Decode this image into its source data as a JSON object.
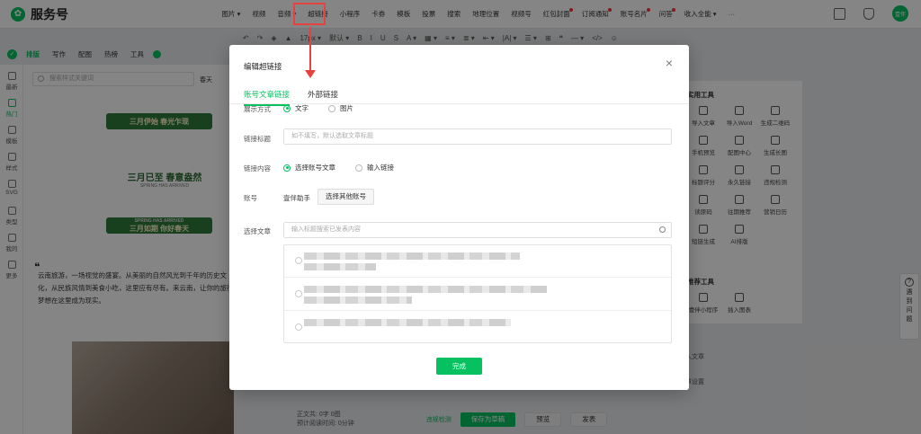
{
  "brand": {
    "name": "服务号"
  },
  "menu": [
    {
      "label": "图片",
      "arrow": "▾",
      "dot": false
    },
    {
      "label": "视频",
      "arrow": "",
      "dot": false
    },
    {
      "label": "音频",
      "arrow": "▾",
      "dot": false
    },
    {
      "label": "超链接",
      "arrow": "",
      "dot": false,
      "highlight": true
    },
    {
      "label": "小程序",
      "arrow": "",
      "dot": false
    },
    {
      "label": "卡券",
      "arrow": "",
      "dot": false
    },
    {
      "label": "模板",
      "arrow": "",
      "dot": false
    },
    {
      "label": "投票",
      "arrow": "",
      "dot": false
    },
    {
      "label": "搜索",
      "arrow": "",
      "dot": false
    },
    {
      "label": "地理位置",
      "arrow": "",
      "dot": false
    },
    {
      "label": "视频号",
      "arrow": "",
      "dot": false
    },
    {
      "label": "红包封面",
      "arrow": "",
      "dot": true
    },
    {
      "label": "订阅通知",
      "arrow": "",
      "dot": true
    },
    {
      "label": "账号名片",
      "arrow": "",
      "dot": true
    },
    {
      "label": "问答",
      "arrow": "",
      "dot": true
    },
    {
      "label": "收入全能",
      "arrow": "▾",
      "dot": false
    },
    {
      "label": "···",
      "arrow": "",
      "dot": false
    }
  ],
  "user": {
    "avatar_text": "壹伴"
  },
  "editor_toolbar": [
    "↶",
    "↷",
    "◈",
    "▲",
    "17px ▾",
    "默认 ▾",
    "B",
    "I",
    "U",
    "S",
    "A ▾",
    "▦ ▾",
    "≡ ▾",
    "≣ ▾",
    "⇤ ▾",
    "|A| ▾",
    "☰ ▾",
    "⊞",
    "❝",
    "— ▾",
    "</>",
    "☺"
  ],
  "left_tools": {
    "items": [
      "排版",
      "写作",
      "配图",
      "热榜",
      "工具"
    ],
    "active": "排版"
  },
  "sidebar": [
    "最新",
    "热门",
    "模板",
    "样式",
    "SVG",
    "类型",
    "我的",
    "更多"
  ],
  "template_panel": {
    "search_placeholder": "搜索样式关键词",
    "tag": "春天",
    "banner1": "三月伊始 春光乍现",
    "banner2": "三月已至 春意盎然",
    "banner2_sub": "SPRING HAS ARRIVED",
    "banner3": "三月如期 你好春天",
    "banner3_sub": "SPRING HAS ARRIVED",
    "article_text": "云南旅游，一场视觉的盛宴。从美丽的自然风光到千年的历史文化，从民族风情到美食小吃，这里应有尽有。来云南，让你的旅行梦想在这里成为现实。"
  },
  "right_panel": {
    "section1_title": "实用工具",
    "tools1": [
      "导入文章",
      "导入Word",
      "生成二维码",
      "手机预览",
      "配图中心",
      "生成长图",
      "标题评分",
      "永久链接",
      "违规检测",
      "读原码",
      "往期推荐",
      "营销日历",
      "短链生成",
      "AI排版"
    ],
    "section2_title": "推荐工具",
    "tools2": [
      "壹伴小程序",
      "插入图表"
    ],
    "extra1": "插入文章",
    "extra2": "文章设置"
  },
  "help_tab": {
    "text": "遇到问题"
  },
  "bottom_bar": {
    "word_count": "正文共: 0字 0图",
    "read_time": "预计阅读时间: 0分钟",
    "check": "违规检测",
    "save": "保存为草稿",
    "preview": "预览",
    "publish": "发表"
  },
  "dialog": {
    "title": "编辑超链接",
    "tabs": [
      "账号文章链接",
      "外部链接"
    ],
    "active_tab": 0,
    "display_label": "展示方式",
    "display_options": [
      "文字",
      "图片"
    ],
    "display_selected": 0,
    "title_label": "链接标题",
    "title_placeholder": "如不填写，默认选取文章标题",
    "content_label": "链接内容",
    "content_options": [
      "选择账号文章",
      "输入链接"
    ],
    "content_selected": 0,
    "account_label": "账号",
    "account_name": "壹伴助手",
    "choose_account": "选择其他账号",
    "article_label": "选择文章",
    "article_placeholder": "输入标题搜索已发表内容",
    "articles_count_visible": 3,
    "finish": "完成"
  }
}
